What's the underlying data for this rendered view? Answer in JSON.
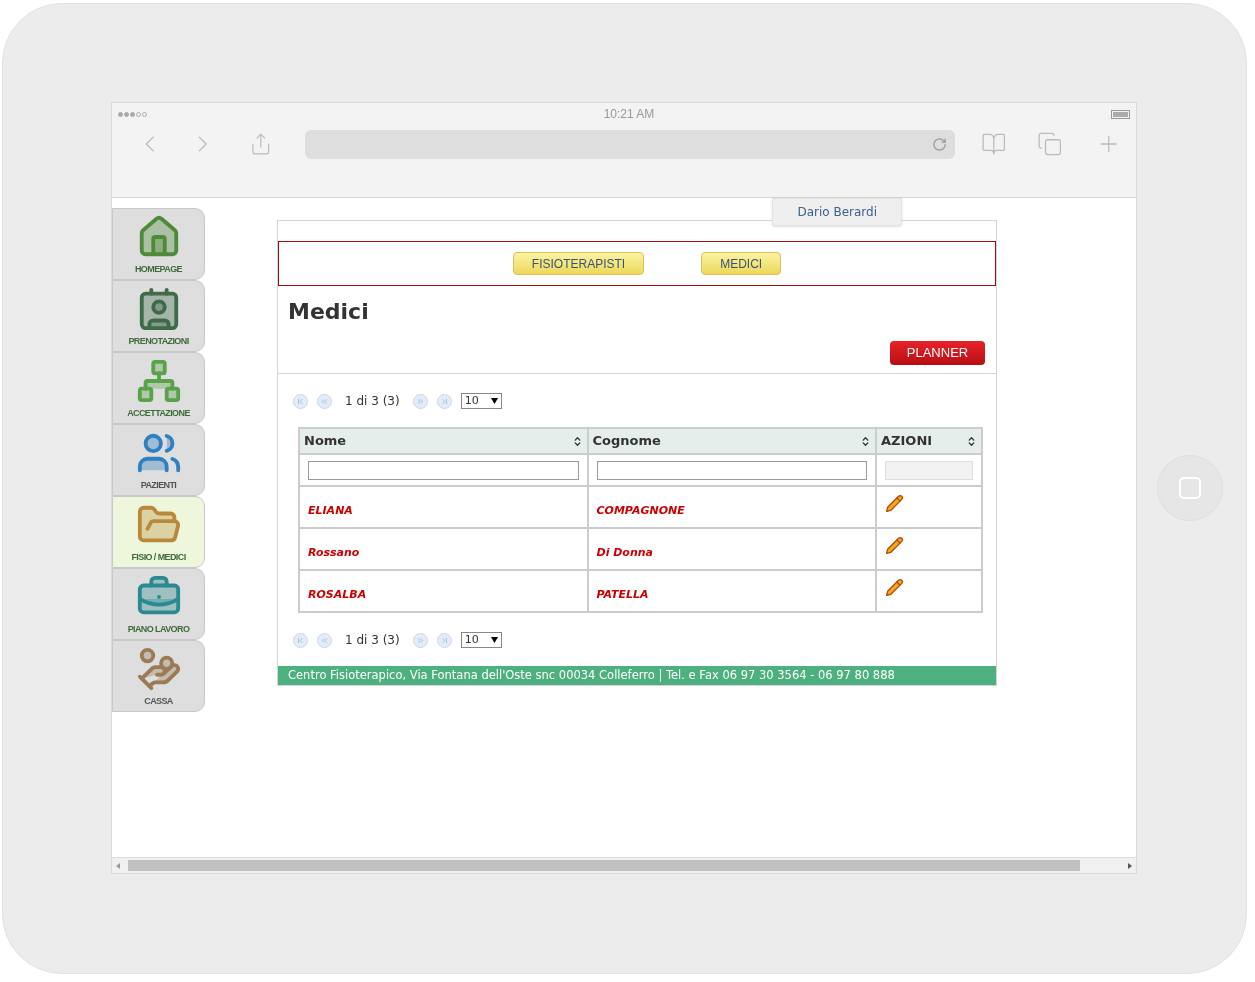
{
  "browser": {
    "time": "10:21 AM"
  },
  "sidebar": {
    "items": [
      {
        "kind": "home",
        "label": "HOMEPAGE",
        "selected": false
      },
      {
        "kind": "booking",
        "label": "PRENOTAZIONI",
        "selected": false
      },
      {
        "kind": "intake",
        "label": "ACCETTAZIONE",
        "selected": false
      },
      {
        "kind": "patients",
        "label": "PAZIENTI",
        "selected": false
      },
      {
        "kind": "staff",
        "label": "FISIO / MEDICI",
        "selected": true
      },
      {
        "kind": "work",
        "label": "PIANO LAVORO",
        "selected": false
      },
      {
        "kind": "cash",
        "label": "CASSA",
        "selected": false
      }
    ]
  },
  "user_menu": {
    "label": "Dario Berardi"
  },
  "tabs": [
    "FISIOTERAPISTI",
    "MEDICI"
  ],
  "title": "Medici",
  "planner_button": "PLANNER",
  "pager_top": {
    "text": "1 di 3 (3)",
    "page_size": "10"
  },
  "table": {
    "columns": [
      {
        "label": "Nome",
        "filter": true
      },
      {
        "label": "Cognome",
        "filter": true
      },
      {
        "label": "AZIONI",
        "filter": false
      }
    ],
    "rows": [
      {
        "nome": "ELIANA",
        "cognome": "COMPAGNONE"
      },
      {
        "nome": "Rossano",
        "cognome": "Di Donna"
      },
      {
        "nome": "ROSALBA",
        "cognome": "PATELLA"
      }
    ]
  },
  "pager_bottom": {
    "text": "1 di 3 (3)",
    "page_size": "10"
  },
  "footer": "Centro Fisioterapico, Via Fontana dell'Oste snc 00034 Colleferro | Tel. e Fax 06 97 30 3564 - 06 97 80 888"
}
